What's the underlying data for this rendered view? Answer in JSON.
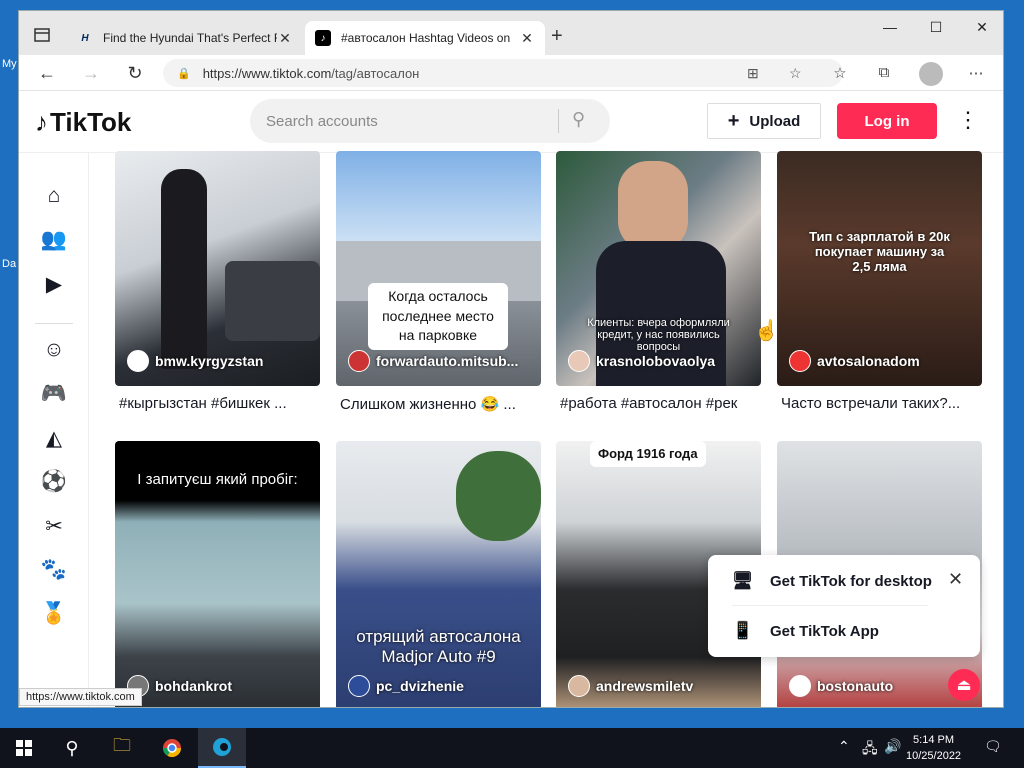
{
  "desktop": {
    "left_labels": [
      "My",
      "Da"
    ]
  },
  "browser": {
    "tabs": [
      {
        "title": "Find the Hyundai That's Perfect F",
        "favicon": "hyundai-icon"
      },
      {
        "title": "#автосалон Hashtag Videos on",
        "favicon": "tiktok-icon",
        "active": true
      }
    ],
    "url_prefix": "https://www.tiktok.com",
    "url_path": "/tag/автосалон",
    "status_url": "https://www.tiktok.com"
  },
  "tiktok": {
    "logo_text": "TikTok",
    "search_placeholder": "Search accounts",
    "upload_label": "Upload",
    "login_label": "Log in",
    "brand_color": "#fe2c55",
    "sidenav_icons": [
      "home-icon",
      "following-icon",
      "live-icon",
      "comedy-icon",
      "gaming-icon",
      "food-icon",
      "sports-icon",
      "beauty-icon",
      "animals-icon",
      "achievement-icon"
    ],
    "videos": [
      {
        "user": "bmw.kyrgyzstan",
        "desc": "#кыргызстан #бишкек ...",
        "overlay": ""
      },
      {
        "user": "forwardauto.mitsub...",
        "desc": "Слишком жизненно 😂 ...",
        "overlay": "Когда осталось последнее место на парковке"
      },
      {
        "user": "krasnolobovaolya",
        "desc": "#работа #автосалон #рек",
        "overlay": "Клиенты: вчера оформляли кредит, у нас появились вопросы"
      },
      {
        "user": "avtosalonadom",
        "desc": "Часто встречали таких?...",
        "overlay": "Тип с зарплатой в 20к покупает машину за 2,5 ляма"
      },
      {
        "user": "bohdankrot",
        "desc": "",
        "overlay": "І запитуєш який пробіг:"
      },
      {
        "user": "pc_dvizhenie",
        "desc": "",
        "overlay": "отрящий автосалона Madjor Auto #9"
      },
      {
        "user": "andrewsmiletv",
        "desc": "",
        "overlay": "Форд 1916 года"
      },
      {
        "user": "bostonauto",
        "desc": "",
        "overlay": ""
      }
    ],
    "popup": {
      "desktop_label": "Get TikTok for desktop",
      "app_label": "Get TikTok App"
    }
  },
  "taskbar": {
    "time": "5:14 PM",
    "date": "10/25/2022"
  }
}
